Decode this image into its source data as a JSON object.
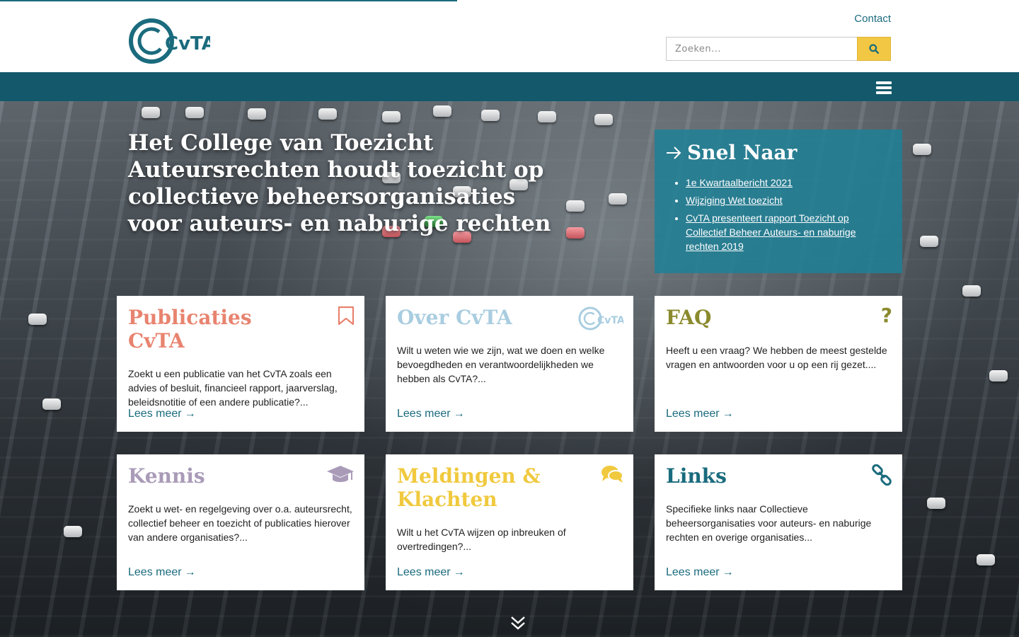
{
  "header": {
    "logo_text": "CvTA",
    "contact_link": "Contact",
    "search": {
      "placeholder": "Zoeken...",
      "button_icon": "search-icon"
    }
  },
  "navbar": {
    "menu_icon": "hamburger-icon"
  },
  "hero": {
    "title": "Het College van Toezicht Auteursrechten houdt toezicht op collectieve beheersorganisaties voor auteurs- en naburige rechten"
  },
  "quick_links": {
    "heading": "Snel Naar",
    "items": [
      {
        "label": "1e Kwartaalbericht 2021"
      },
      {
        "label": "Wijziging Wet toezicht"
      },
      {
        "label": "CvTA presenteert rapport Toezicht op Collectief Beheer Auteurs- en naburige rechten 2019"
      }
    ]
  },
  "cards": [
    {
      "title": "Publicaties CvTA",
      "color": "#e8836f",
      "icon": "bookmark-icon",
      "text": "Zoekt u een publicatie van het CvTA zoals een advies of besluit, financieel rapport, jaarverslag, beleidsnotitie of een andere publicatie?...",
      "more": "Lees meer"
    },
    {
      "title": "Over CvTA",
      "color": "#a9cde0",
      "icon": "cvta-logo-icon",
      "text": "Wilt u weten wie we zijn, wat we doen en welke bevoegdheden en verantwoordelijkheden we hebben als CvTA?...",
      "more": "Lees meer"
    },
    {
      "title": "FAQ",
      "color": "#8a8a2e",
      "icon": "question-icon",
      "text": "Heeft u een vraag? We hebben de meest gestelde vragen en antwoorden voor u op een rij gezet....",
      "more": "Lees meer"
    },
    {
      "title": "Kennis",
      "color": "#a99bb8",
      "icon": "graduation-cap-icon",
      "text": "Zoekt u wet- en regelgeving over o.a. auteursrecht, collectief beheer en toezicht of publicaties hierover van andere organisaties?...",
      "more": "Lees meer"
    },
    {
      "title": "Meldingen & Klachten",
      "color": "#f0c93e",
      "icon": "comments-icon",
      "text": "Wilt u het CvTA wijzen op inbreuken of overtredingen?...",
      "more": "Lees meer"
    },
    {
      "title": "Links",
      "color": "#1a6b7d",
      "icon": "link-icon",
      "text": "Specifieke links naar Collectieve beheersorganisaties voor auteurs- en naburige rechten en overige organisaties...",
      "more": "Lees meer"
    }
  ],
  "colors": {
    "brand": "#1a6b7d",
    "search_button": "#f2c744"
  }
}
